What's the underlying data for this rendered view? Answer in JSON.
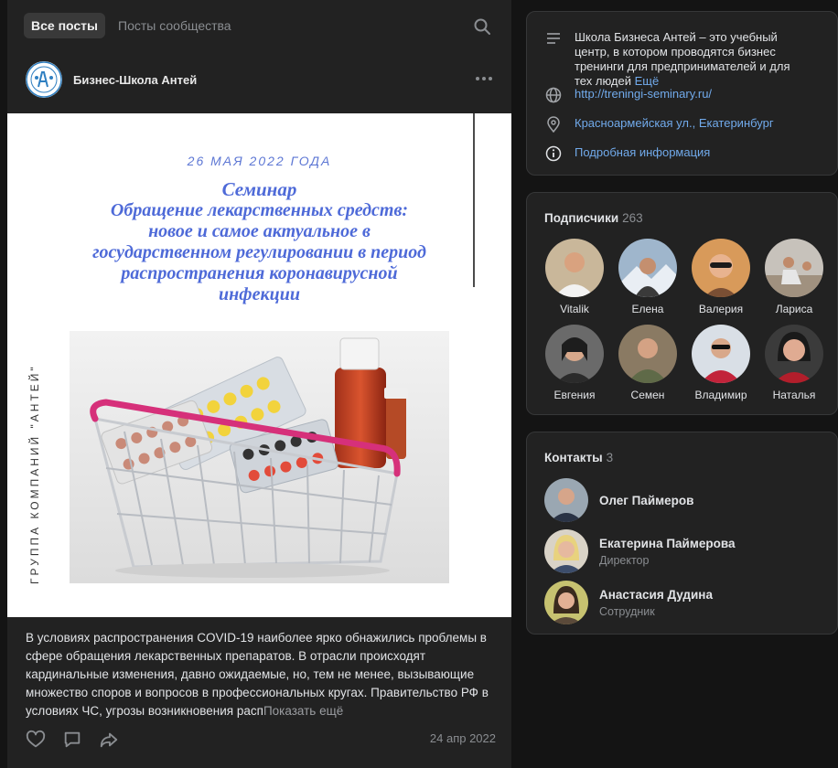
{
  "tabs": [
    {
      "label": "Все посты",
      "active": true
    },
    {
      "label": "Посты сообщества",
      "active": false
    }
  ],
  "post": {
    "author": "Бизнес-Школа Антей",
    "image": {
      "date": "26 МАЯ 2022 ГОДА",
      "title_lines": [
        "Семинар",
        "Обращение лекарственных средств:",
        "новое и самое актуальное в",
        "государственном регулировании в период",
        "распространения коронавирусной",
        "инфекции"
      ],
      "side_text": "ГРУППА КОМПАНИЙ \"АНТЕЙ\""
    },
    "text": "В условиях распространения COVID-19 наиболее ярко обнажились проблемы в сфере обращения лекарственных препаратов. В отрасли происходят кардинальные изменения, давно ожидаемые, но, тем не менее, вызывающие множество споров и вопросов в профессиональных кругах. Правительство РФ в условиях ЧС, угрозы возникновения расп",
    "show_more": "Показать ещё",
    "date": "24 апр 2022"
  },
  "info": {
    "description": "Школа Бизнеса Антей – это учебный центр, в котором проводятся бизнес тренинги для предпринимателей и для тех людей",
    "description_more": "Ещё",
    "website": "http://treningi-seminary.ru/",
    "address": "Красноармейская ул., Екатеринбург",
    "details": "Подробная информация"
  },
  "subscribers": {
    "title": "Подписчики",
    "count": "263",
    "people": [
      {
        "name": "Vitalik"
      },
      {
        "name": "Елена"
      },
      {
        "name": "Валерия"
      },
      {
        "name": "Лариса"
      },
      {
        "name": "Евгения"
      },
      {
        "name": "Семен"
      },
      {
        "name": "Владимир"
      },
      {
        "name": "Наталья"
      }
    ]
  },
  "contacts": {
    "title": "Контакты",
    "count": "3",
    "people": [
      {
        "name": "Олег Паймеров",
        "role": ""
      },
      {
        "name": "Екатерина Паймерова",
        "role": "Директор"
      },
      {
        "name": "Анастасия Дудина",
        "role": "Сотрудник"
      }
    ]
  },
  "colors": {
    "background": "#141414",
    "card": "#222222",
    "link": "#71aaeb",
    "accent_image": "#4e6ad8"
  }
}
